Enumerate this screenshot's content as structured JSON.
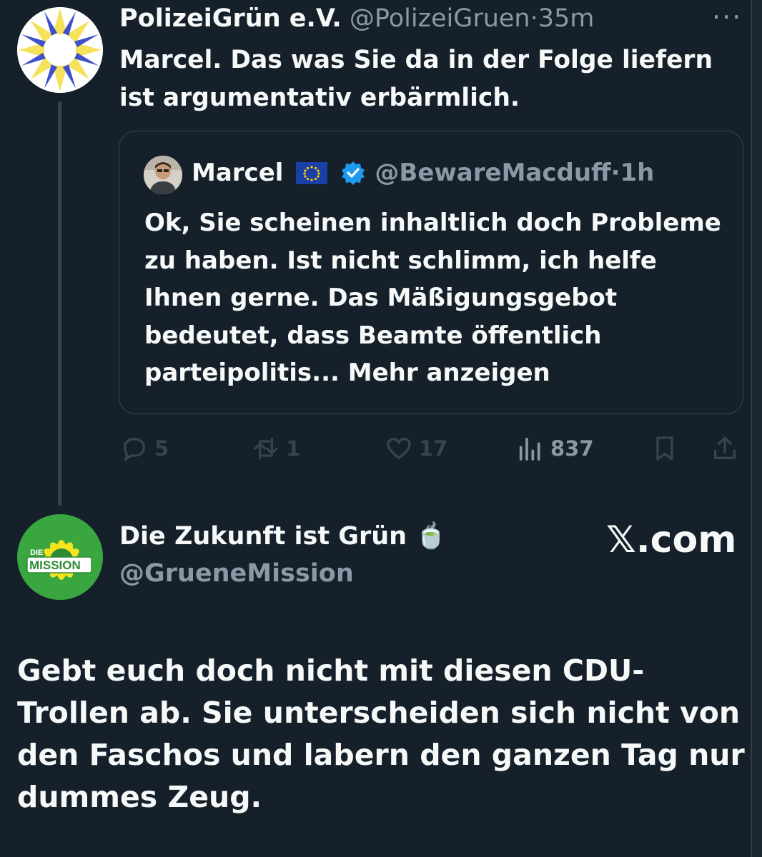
{
  "tweet": {
    "author_name": "PolizeiGrün e.V.",
    "author_handle": "@PolizeiGruen",
    "separator": "·",
    "time": "35m",
    "more_label": "···",
    "text": "Marcel. Das was Sie da in der Folge liefern ist argumentativ erbärmlich.",
    "avatar_icon": "sunflower-logo-icon"
  },
  "quoted_tweet": {
    "author_name": "Marcel",
    "flag_icon": "eu-flag-icon",
    "verified_icon": "verified-badge-icon",
    "author_handle": "@BewareMacduff",
    "separator": "·",
    "time": "1h",
    "text": "Ok, Sie scheinen inhaltlich doch Probleme zu haben. Ist nicht schlimm, ich helfe Ihnen gerne. Das Mäßigungsgebot bedeutet, dass Beamte öffentlich parteipolitis... Mehr anzeigen"
  },
  "actions": {
    "replies": "5",
    "reposts": "1",
    "likes": "17",
    "views": "837",
    "reply_icon": "reply-icon",
    "repost_icon": "repost-icon",
    "like_icon": "heart-icon",
    "views_icon": "views-icon",
    "bookmark_icon": "bookmark-icon",
    "share_icon": "share-icon"
  },
  "embed_tweet": {
    "author_name": "Die Zukunft ist Grün",
    "author_emoji": "🍵",
    "author_handle": "@GrueneMission",
    "avatar_label_top": "DIE",
    "avatar_label_main": "MISSION",
    "source_label": "𝕏.com",
    "text": "Gebt euch doch nicht mit diesen CDU-Trollen ab. Sie unterscheiden sich nicht von den Faschos und labern den ganzen Tag nur dummes Zeug."
  },
  "colors": {
    "background": "#15202b",
    "text_primary": "#f7f9f9",
    "text_muted": "#8b98a5",
    "border": "#38444d",
    "verified_blue": "#1d9bf0"
  }
}
